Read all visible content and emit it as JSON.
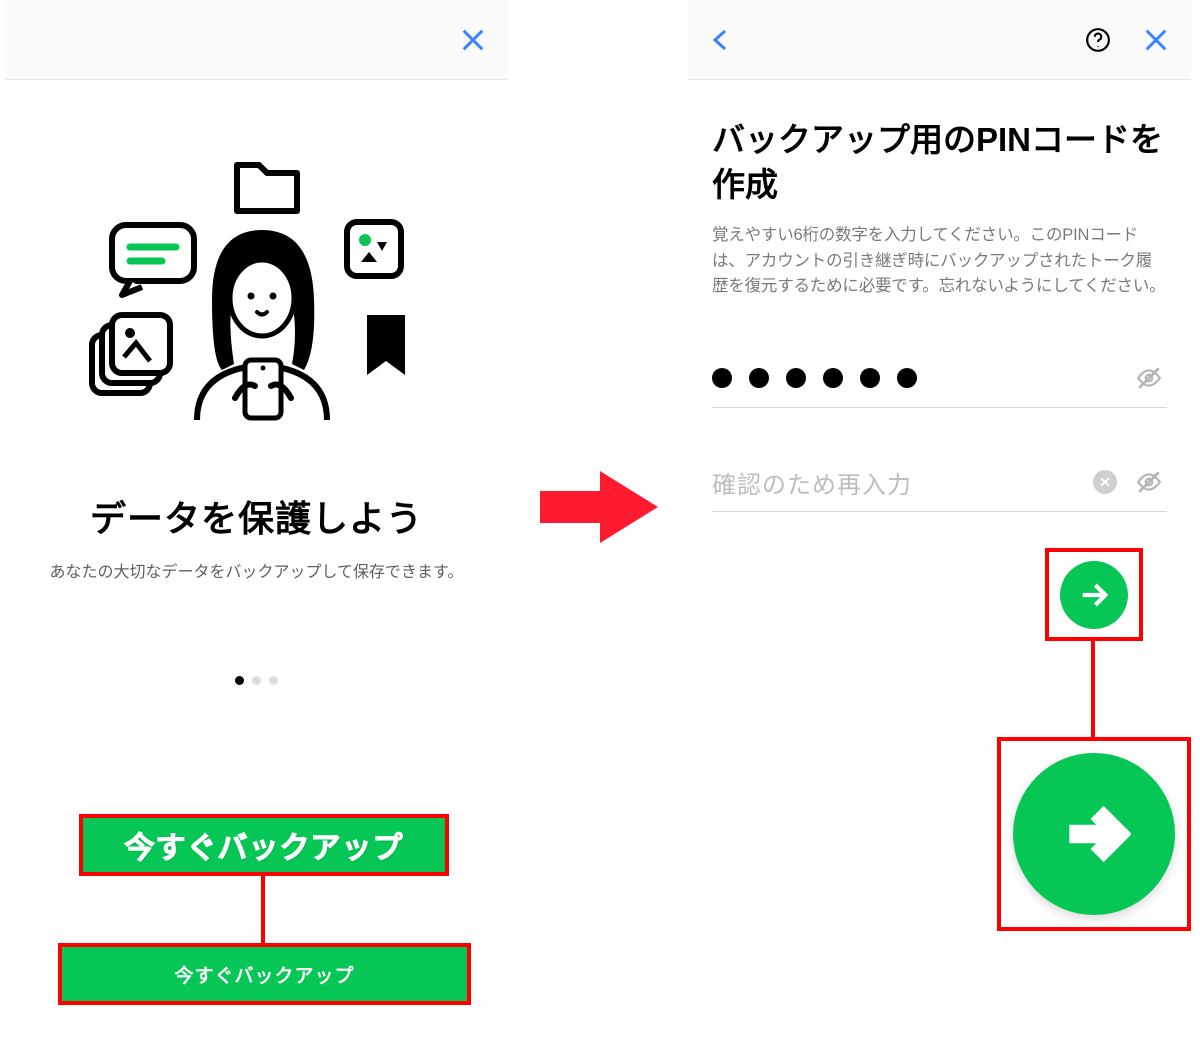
{
  "left": {
    "title": "データを保護しよう",
    "subtitle": "あなたの大切なデータをバックアップして保存できます。",
    "callout_label": "今すぐバックアップ",
    "primary_button_label": "今すぐバックアップ"
  },
  "right": {
    "title": "バックアップ用のPINコードを作成",
    "description": "覚えやすい6桁の数字を入力してください。このPINコードは、アカウントの引き継ぎ時にバックアップされたトーク履歴を復元するために必要です。忘れないようにしてください。",
    "pin_masked": "●●●●●●",
    "confirm_placeholder": "確認のため再入力"
  },
  "colors": {
    "accent_green": "#06c755",
    "highlight_red": "#ff0000",
    "link_blue": "#3a82ff"
  }
}
